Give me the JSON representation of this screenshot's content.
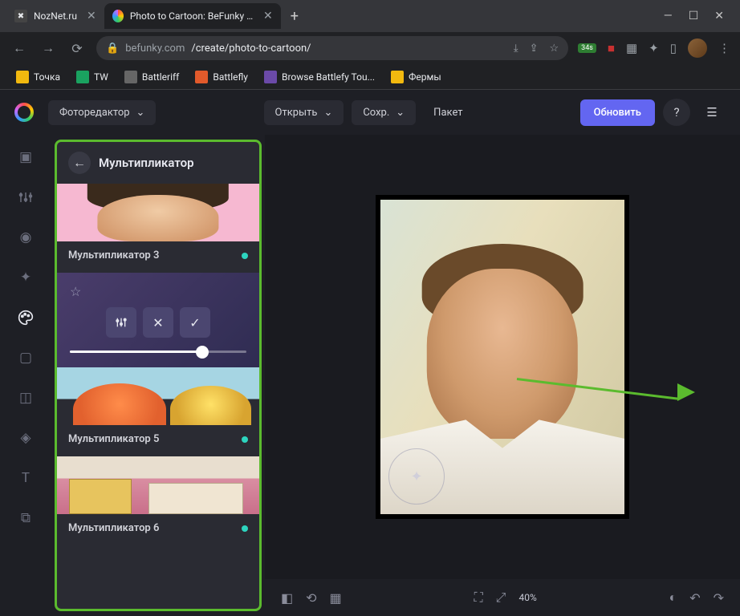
{
  "browser": {
    "tabs": [
      {
        "title": "NozNet.ru",
        "active": false
      },
      {
        "title": "Photo to Cartoon: BeFunky - Cart",
        "active": true
      }
    ],
    "url_host": "befunky.com",
    "url_path": "/create/photo-to-cartoon/",
    "ext_badge": "34s",
    "bookmarks": [
      {
        "label": "Точка",
        "color": "#f2b90f"
      },
      {
        "label": "TW",
        "color": "#1aa260"
      },
      {
        "label": "Battleriff",
        "color": "#9a9a9a"
      },
      {
        "label": "Battlefly",
        "color": "#e25a2b"
      },
      {
        "label": "Browse Battlefy Tou...",
        "color": "#6b4aa8"
      },
      {
        "label": "Фермы",
        "color": "#f2b90f"
      }
    ]
  },
  "app": {
    "editor_label": "Фоторедактор",
    "open_label": "Открыть",
    "save_label": "Сохр.",
    "batch_label": "Пакет",
    "upgrade_label": "Обновить",
    "panel_title": "Мультипликатор",
    "effects": {
      "e3": "Мультипликатор 3",
      "e5": "Мультипликатор 5",
      "e6": "Мультипликатор 6"
    },
    "zoom": "40%",
    "slider_percent": 75
  }
}
